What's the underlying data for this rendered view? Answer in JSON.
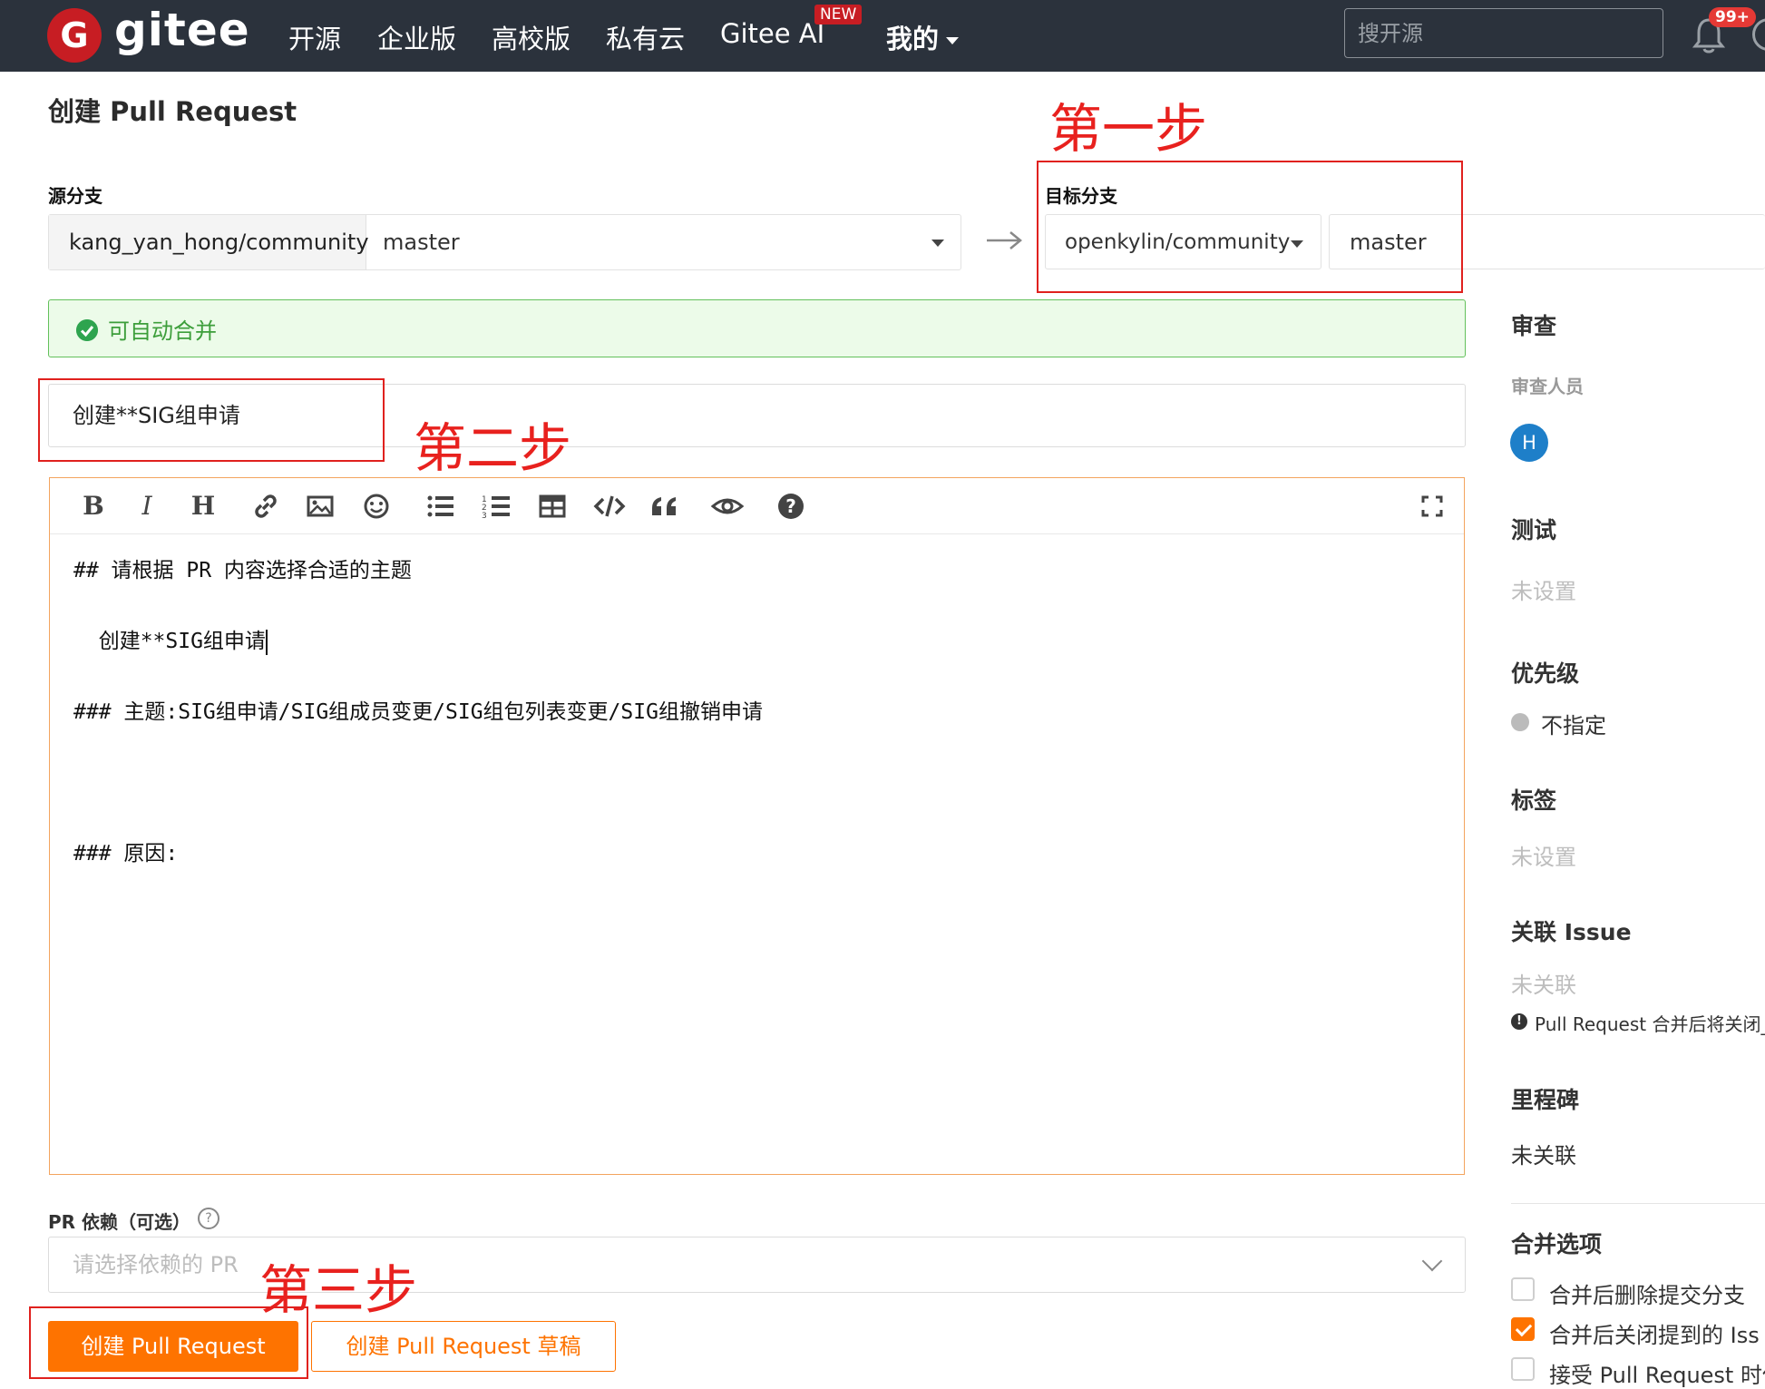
{
  "nav": {
    "brand": "gitee",
    "logo_letter": "G",
    "items": [
      "开源",
      "企业版",
      "高校版",
      "私有云",
      "Gitee AI",
      "我的"
    ],
    "new_badge": "NEW",
    "search_placeholder": "搜开源",
    "notification_count": "99+"
  },
  "page": {
    "title": "创建 Pull Request"
  },
  "source": {
    "label": "源分支",
    "repo": "kang_yan_hong/community",
    "branch": "master"
  },
  "target": {
    "label": "目标分支",
    "repo": "openkylin/community",
    "branch": "master"
  },
  "merge_status": "可自动合并",
  "pr_title": "创建**SIG组申请",
  "editor": {
    "lines": [
      "## 请根据 PR 内容选择合适的主题",
      "  创建**SIG组申请",
      "### 主题:SIG组申请/SIG组成员变更/SIG组包列表变更/SIG组撤销申请",
      "### 原因:"
    ]
  },
  "dependency": {
    "label": "PR 依赖（可选）",
    "placeholder": "请选择依赖的 PR"
  },
  "buttons": {
    "create": "创建 Pull Request",
    "draft": "创建 Pull Request 草稿"
  },
  "sidebar": {
    "review": {
      "title": "审查",
      "subtitle": "审查人员",
      "avatar_letter": "H"
    },
    "test": {
      "title": "测试",
      "value": "未设置"
    },
    "priority": {
      "title": "优先级",
      "value": "不指定"
    },
    "labels": {
      "title": "标签",
      "value": "未设置"
    },
    "issue": {
      "title": "关联 Issue",
      "value": "未关联",
      "note": "Pull Request 合并后将关闭_"
    },
    "milestone": {
      "title": "里程碑",
      "value": "未关联"
    },
    "merge_options": {
      "title": "合并选项",
      "options": [
        {
          "label": "合并后删除提交分支",
          "checked": false
        },
        {
          "label": "合并后关闭提到的 Iss",
          "checked": true
        },
        {
          "label": "接受 Pull Request 时使",
          "checked": false
        }
      ]
    }
  },
  "annotations": {
    "step1": "第一步",
    "step2": "第二步",
    "step3": "第三步"
  },
  "colors": {
    "nav_bg": "#2b323c",
    "brand_red": "#c71d23",
    "accent_orange": "#fe7300",
    "success_green": "#3c9e3a",
    "annotation_red": "#e0211e"
  }
}
